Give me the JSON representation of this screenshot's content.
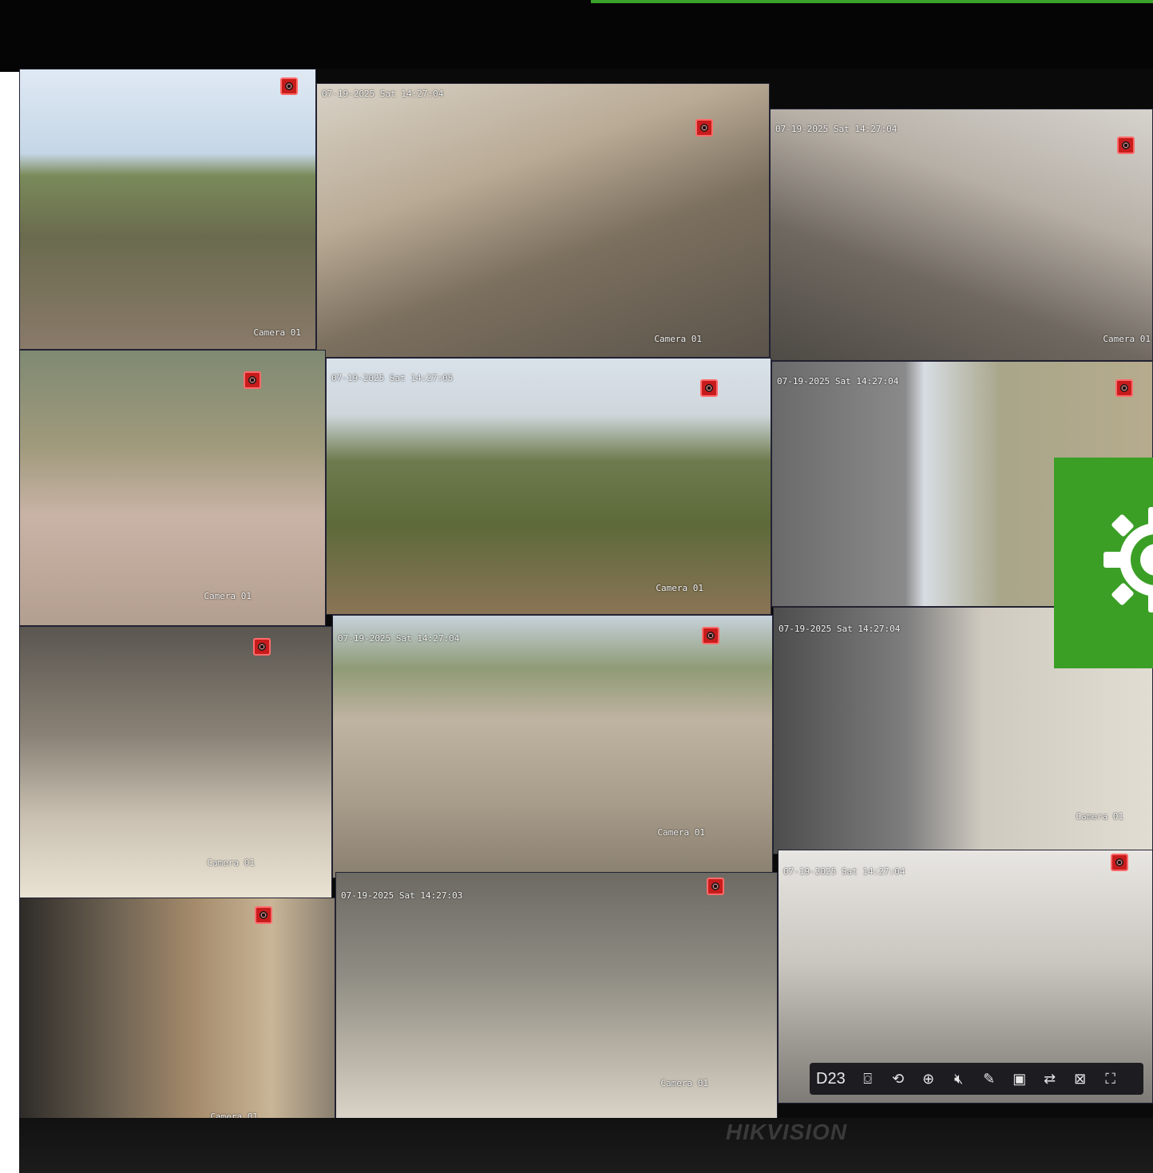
{
  "osd": {
    "timestamp_full": "07-19-2025 Sat 14:27:04",
    "timestamp_03": "07-19-2025 Sat 14:27:03",
    "timestamp_05": "07-19-2025 Sat 14:27:05",
    "timestamp_short": "07-19-2025 Sat 14:27:04",
    "camera_label": "Camera 01"
  },
  "toolbar": {
    "channel": "D23",
    "buttons": [
      "camera-icon",
      "playback-icon",
      "zoom-in-icon",
      "mute-icon",
      "mic-off-icon",
      "display-icon",
      "switch-icon",
      "stream-icon",
      "fullscreen-icon"
    ]
  },
  "brand": {
    "name": "HIKVISION"
  },
  "colors": {
    "accent_green": "#3b9f26",
    "rec_red": "#c81c1c"
  }
}
